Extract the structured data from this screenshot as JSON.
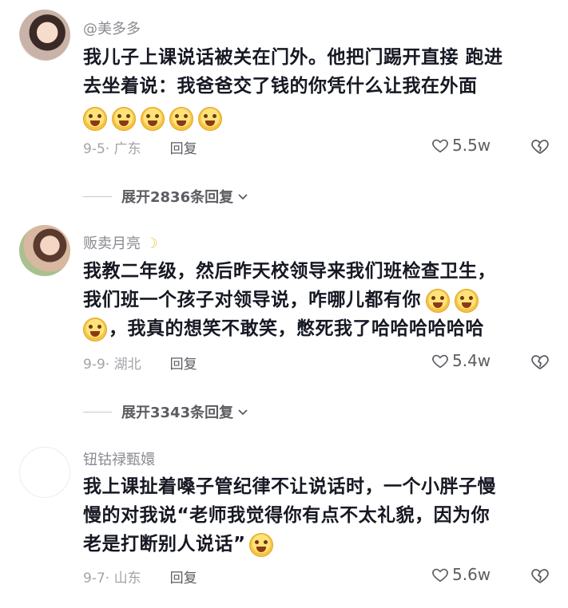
{
  "comments": [
    {
      "username": "@美多多",
      "text": "我儿子上课说话被关在门外。他把门踢开直接 跑进去坐着说：我爸爸交了钱的你凭什么让我在外面",
      "line1": "我儿子上课说话被关在门外。他把门踢开直接 跑进",
      "line2": "去坐着说：我爸爸交了钱的你凭什么让我在外面",
      "emoji_count": 5,
      "date_location": "9-5· 广东",
      "reply_label": "回复",
      "likes": "5.5w",
      "expand_label": "展开2836条回复"
    },
    {
      "username": "贩卖月亮",
      "text": "我教二年级，然后昨天校领导来我们班检查卫生，我们班一个孩子对领导说，咋哪儿都有你，我真的想笑不敢笑，憋死我了哈哈哈哈哈哈",
      "line1": "我教二年级，然后昨天校领导来我们班检查卫生，",
      "line2": "我们班一个孩子对领导说，咋哪儿都有你",
      "line3": "，我真的想笑不敢笑，憋死我了哈哈哈哈哈哈",
      "date_location": "9-9· 湖北",
      "reply_label": "回复",
      "likes": "5.4w",
      "expand_label": "展开3343条回复"
    },
    {
      "username": "钮钴禄甄嬛",
      "line1": "我上课扯着嗓子管纪律不让说话时，一个小胖子慢",
      "line2": "慢的对我说“老师我觉得你有点不太礼貌，因为你",
      "line3": "老是打断别人说话”",
      "date_location": "9-7· 山东",
      "reply_label": "回复",
      "likes": "5.6w"
    }
  ],
  "icons": {
    "like": "heart-outline-icon",
    "dislike": "broken-heart-icon",
    "expand": "chevron-down-icon"
  },
  "colors": {
    "text": "#161823",
    "secondary": "#8a8b91",
    "meta": "#a3a4a9"
  }
}
